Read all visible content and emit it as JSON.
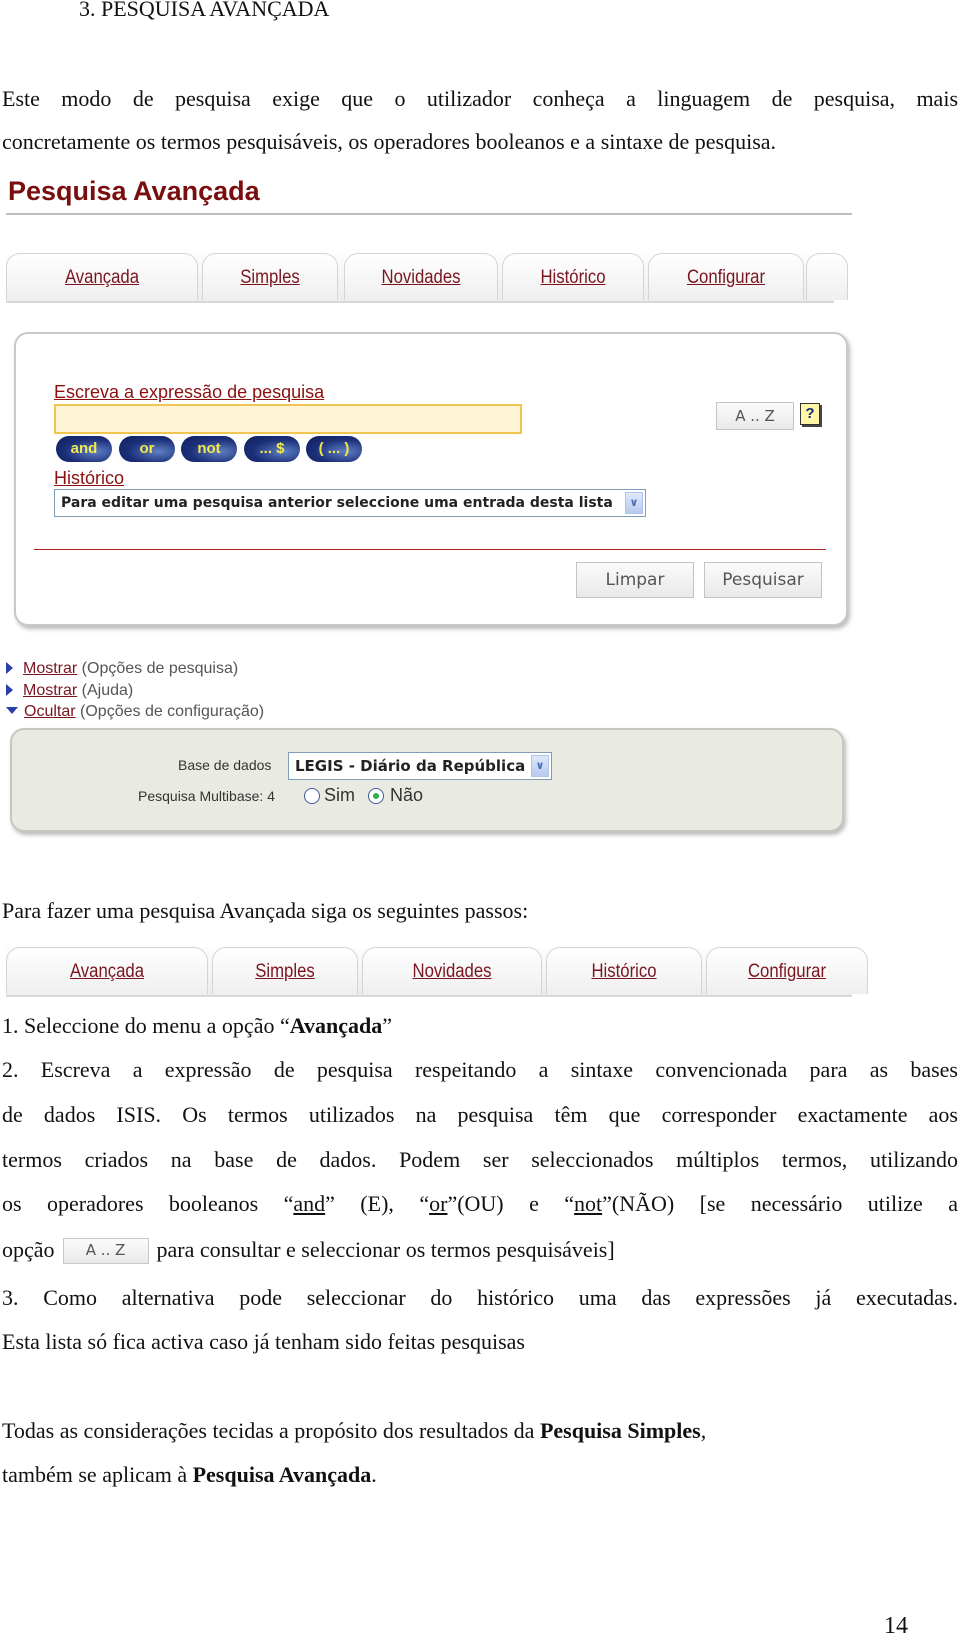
{
  "doc": {
    "heading": "3. PESQUISA AVANÇADA",
    "intro_line1": "Este modo de pesquisa exige que o utilizador conheça a linguagem de pesquisa, mais",
    "intro_line2": "concretamente os termos pesquisáveis, os operadores booleanos e a sintaxe de pesquisa.",
    "steps_intro": "Para fazer uma pesquisa Avançada siga os seguintes passos:",
    "step1_prefix": "1. Seleccione do menu a opção “",
    "step1_bold": "Avançada",
    "step1_suffix": "”",
    "step2_line1": "2. Escreva a expressão de pesquisa respeitando a sintaxe convencionada para as bases",
    "step2_line2": "de dados ISIS. Os termos utilizados na pesquisa têm que corresponder exactamente aos",
    "step2_line3": "termos criados na base de dados. Podem ser seleccionados múltiplos termos, utilizando",
    "step2_line4": {
      "a": "os operadores booleanos “",
      "and": "and",
      "b": "” (E), “",
      "or": "or",
      "c": "”(OU) e “",
      "not": "not",
      "d": "”(NÃO) [se necessário utilize a"
    },
    "step2_line5_prefix": "opção",
    "step2_line5_button": "A .. Z",
    "step2_line5_suffix": "para consultar e seleccionar os termos pesquisáveis]",
    "step3_line1": "3. Como alternativa pode seleccionar do histórico uma das expressões já executadas.",
    "step3_line2": "Esta lista só fica activa caso já tenham sido feitas pesquisas",
    "closing_line1_prefix": "Todas as considerações tecidas a propósito dos resultados da ",
    "closing_line1_bold": "Pesquisa Simples",
    "closing_line1_suffix": ",",
    "closing_line2_prefix": "também se aplicam à ",
    "closing_line2_bold": "Pesquisa Avançada",
    "closing_line2_suffix": ".",
    "page_number": "14"
  },
  "app": {
    "title": "Pesquisa Avançada",
    "tabs": [
      {
        "label": "Avançada"
      },
      {
        "label": "Simples"
      },
      {
        "label": "Novidades"
      },
      {
        "label": "Histórico"
      },
      {
        "label": "Configurar"
      }
    ],
    "search": {
      "expression_label": "Escreva a expressão de pesquisa",
      "expression_value": "",
      "operators": [
        "and",
        "or",
        "not",
        "... $",
        "( ... )"
      ],
      "az_button": "A .. Z",
      "help_button": "?",
      "history_label": "Histórico",
      "history_selected": "Para editar uma pesquisa anterior seleccione uma entrada desta lista",
      "clear_button": "Limpar",
      "search_button": "Pesquisar"
    },
    "toggles": [
      {
        "link": "Mostrar",
        "text": " (Opções de pesquisa)",
        "state": "collapsed"
      },
      {
        "link": "Mostrar",
        "text": " (Ajuda)",
        "state": "collapsed"
      },
      {
        "link": "Ocultar",
        "text": " (Opções de configuração)",
        "state": "expanded"
      }
    ],
    "config": {
      "database_label": "Base de dados",
      "database_selected": "LEGIS - Diário da República",
      "multibase_label": "Pesquisa Multibase: 4",
      "multibase_options": [
        {
          "label": "Sim",
          "checked": false
        },
        {
          "label": "Não",
          "checked": true
        }
      ]
    }
  },
  "colors": {
    "title_red": "#7a0e0e",
    "link_red": "#7a1520",
    "operator_blue": "#1b2f79",
    "operator_text": "#f2e94a",
    "input_fill": "#fff3d6",
    "config_bg": "#e9ebe2"
  }
}
